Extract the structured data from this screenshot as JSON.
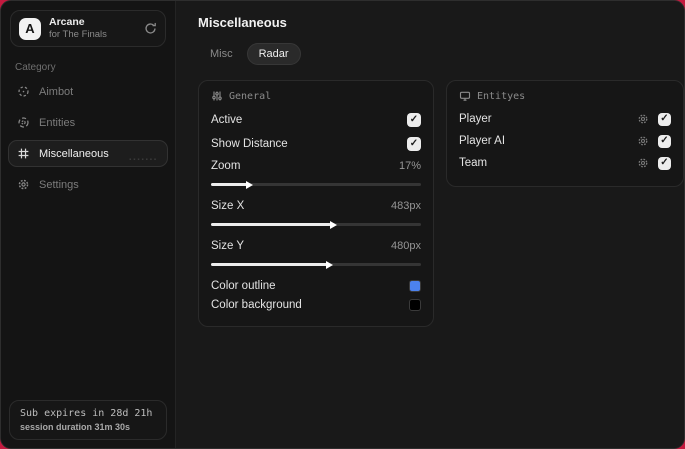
{
  "app": {
    "logo_letter": "A",
    "name": "Arcane",
    "subtitle": "for The Finals"
  },
  "sidebar": {
    "category_label": "Category",
    "items": [
      {
        "label": "Aimbot",
        "icon": "crosshair-icon",
        "active": false
      },
      {
        "label": "Entities",
        "icon": "radar-icon",
        "active": false
      },
      {
        "label": "Miscellaneous",
        "icon": "grid-icon",
        "active": true
      },
      {
        "label": "Settings",
        "icon": "gear-icon",
        "active": false
      }
    ],
    "footer": {
      "expiry": "Sub expires in 28d 21h",
      "session": "session duration 31m 30s"
    }
  },
  "main": {
    "title": "Miscellaneous",
    "tabs": [
      {
        "label": "Misc",
        "active": false
      },
      {
        "label": "Radar",
        "active": true
      }
    ]
  },
  "general_panel": {
    "title": "General",
    "icon": "sliders-icon",
    "toggles": [
      {
        "label": "Active",
        "checked": true
      },
      {
        "label": "Show Distance",
        "checked": true
      }
    ],
    "sliders": [
      {
        "label": "Zoom",
        "value": "17%",
        "percent": 17
      },
      {
        "label": "Size X",
        "value": "483px",
        "percent": 57
      },
      {
        "label": "Size Y",
        "value": "480px",
        "percent": 55
      }
    ],
    "color_rows": [
      {
        "label": "Color outline",
        "swatch": "#4c82ef"
      },
      {
        "label": "Color background",
        "swatch": "#000000"
      }
    ]
  },
  "entities_panel": {
    "title": "Entityes",
    "icon": "monitor-icon",
    "rows": [
      {
        "label": "Player",
        "checked": true
      },
      {
        "label": "Player AI",
        "checked": true
      },
      {
        "label": "Team",
        "checked": true
      }
    ]
  },
  "colors": {
    "backdrop": "#c41a3f",
    "accent_blue": "#4c82ef",
    "checkmark": "#1c1c1c"
  }
}
